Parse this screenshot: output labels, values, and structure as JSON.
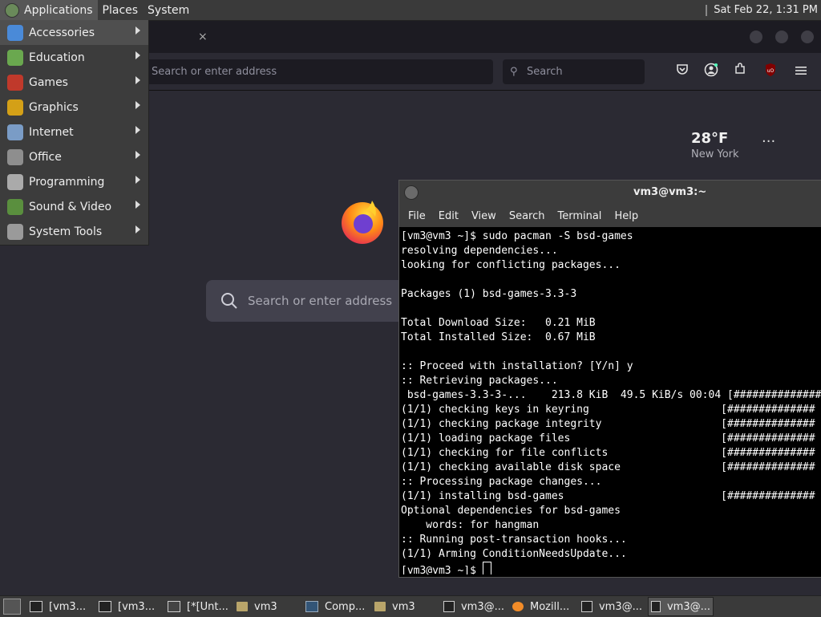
{
  "top_panel": {
    "applications": "Applications",
    "places": "Places",
    "system": "System",
    "clock": "Sat Feb 22,  1:31 PM"
  },
  "app_menu": {
    "items": [
      {
        "label": "Accessories",
        "icon": "accessories-icon",
        "color": "#4a8ad8"
      },
      {
        "label": "Education",
        "icon": "education-icon",
        "color": "#6aa84f"
      },
      {
        "label": "Games",
        "icon": "games-icon",
        "color": "#c0392b"
      },
      {
        "label": "Graphics",
        "icon": "graphics-icon",
        "color": "#d4a017"
      },
      {
        "label": "Internet",
        "icon": "internet-icon",
        "color": "#7a9cc6"
      },
      {
        "label": "Office",
        "icon": "office-icon",
        "color": "#8e8e8e"
      },
      {
        "label": "Programming",
        "icon": "programming-icon",
        "color": "#aaaaaa"
      },
      {
        "label": "Sound & Video",
        "icon": "sound-video-icon",
        "color": "#5a8f3e"
      },
      {
        "label": "System Tools",
        "icon": "system-tools-icon",
        "color": "#9a9a9a"
      }
    ]
  },
  "firefox": {
    "tab_close": "×",
    "url_placeholder": "Search or enter address",
    "search_placeholder": "Search",
    "weather_temp": "28°F",
    "weather_city": "New York",
    "weather_more": "···",
    "newtab_search_placeholder": "Search or enter address"
  },
  "terminal": {
    "title": "vm3@vm3:~",
    "menu": [
      "File",
      "Edit",
      "View",
      "Search",
      "Terminal",
      "Help"
    ],
    "lines": [
      "[vm3@vm3 ~]$ sudo pacman -S bsd-games",
      "resolving dependencies...",
      "looking for conflicting packages...",
      "",
      "Packages (1) bsd-games-3.3-3",
      "",
      "Total Download Size:   0.21 MiB",
      "Total Installed Size:  0.67 MiB",
      "",
      ":: Proceed with installation? [Y/n] y",
      ":: Retrieving packages...",
      " bsd-games-3.3-3-...    213.8 KiB  49.5 KiB/s 00:04 [##############",
      "(1/1) checking keys in keyring                     [##############",
      "(1/1) checking package integrity                   [##############",
      "(1/1) loading package files                        [##############",
      "(1/1) checking for file conflicts                  [##############",
      "(1/1) checking available disk space                [##############",
      ":: Processing package changes...",
      "(1/1) installing bsd-games                         [##############",
      "Optional dependencies for bsd-games",
      "    words: for hangman",
      ":: Running post-transaction hooks...",
      "(1/1) Arming ConditionNeedsUpdate...",
      "[vm3@vm3 ~]$ "
    ]
  },
  "taskbar": {
    "items": [
      {
        "label": "[vm3...",
        "icon": "terminal-icon",
        "kind": "term"
      },
      {
        "label": "[vm3...",
        "icon": "terminal-icon",
        "kind": "term"
      },
      {
        "label": "[*[Unt...",
        "icon": "document-icon",
        "kind": "doc"
      },
      {
        "label": "vm3",
        "icon": "folder-icon",
        "kind": "folder"
      },
      {
        "label": "Comp...",
        "icon": "computer-icon",
        "kind": "comp"
      },
      {
        "label": "vm3",
        "icon": "folder-icon",
        "kind": "folder"
      },
      {
        "label": "vm3@...",
        "icon": "terminal-icon",
        "kind": "term"
      },
      {
        "label": "Mozill...",
        "icon": "firefox-icon",
        "kind": "fox"
      },
      {
        "label": "vm3@...",
        "icon": "terminal-icon",
        "kind": "term"
      },
      {
        "label": "vm3@...",
        "icon": "terminal-icon",
        "kind": "term",
        "active": true
      }
    ]
  }
}
